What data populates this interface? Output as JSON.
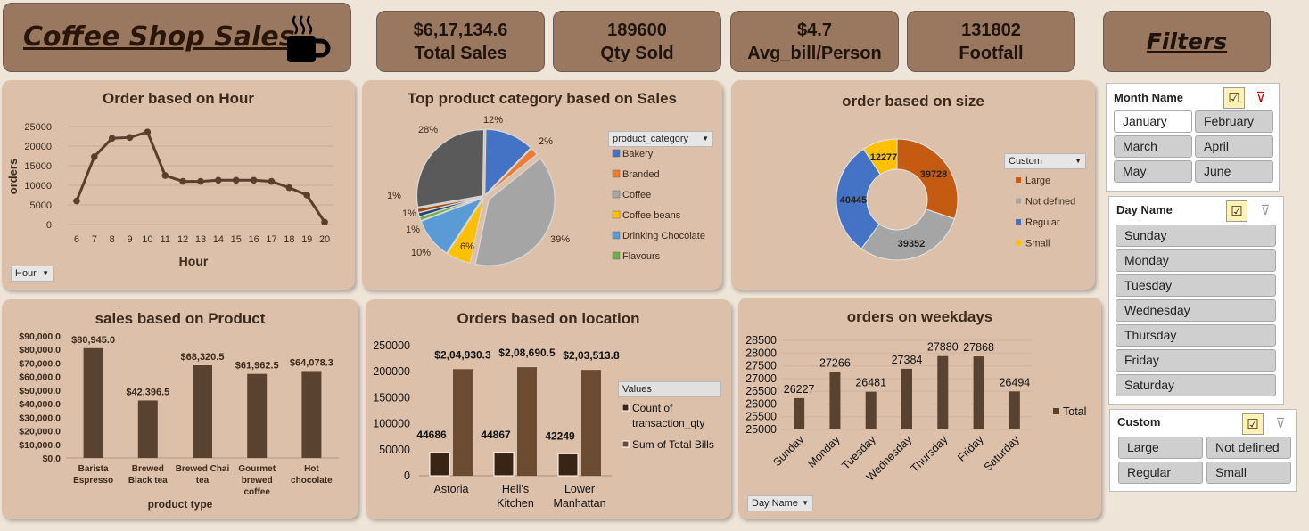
{
  "title": {
    "text": "Coffee Shop Sales",
    "icon": "coffee-cup-icon"
  },
  "kpis": [
    {
      "value": "$6,17,134.6",
      "label": "Total Sales"
    },
    {
      "value": "189600",
      "label": "Qty Sold"
    },
    {
      "value": "$4.7",
      "label": "Avg_bill/Person"
    },
    {
      "value": "131802",
      "label": "Footfall"
    }
  ],
  "filters_label": "Filters",
  "colors": {
    "brown": "#5a4230",
    "panel": "#dcc0aa",
    "header": "#9a7860",
    "blue": "#4472c4",
    "orange": "#ed7d31",
    "grey": "#a5a5a5",
    "gold": "#ffc000",
    "lightblue": "#5b9bd5",
    "green": "#70ad47",
    "darkgrey": "#5a5a5a",
    "rust": "#c55a11"
  },
  "panels": {
    "hour": {
      "title": "Order based on Hour",
      "field_button": "Hour",
      "chart_data": {
        "type": "line",
        "xlabel": "Hour",
        "ylabel": "orders",
        "ylim": [
          0,
          25000
        ],
        "yticks": [
          "25000",
          "20000",
          "15000",
          "10000",
          "5000",
          "0"
        ],
        "x": [
          "6",
          "7",
          "8",
          "9",
          "10",
          "11",
          "12",
          "13",
          "14",
          "15",
          "16",
          "17",
          "18",
          "19",
          "20"
        ],
        "values": [
          6000,
          17300,
          22000,
          22200,
          23600,
          12500,
          11000,
          11000,
          11300,
          11300,
          11300,
          11000,
          9400,
          7500,
          600
        ]
      }
    },
    "category": {
      "title": "Top product category based on Sales",
      "legend_title": "product_category",
      "chart_data": {
        "type": "pie",
        "series": [
          {
            "name": "Bakery",
            "value": 12,
            "label": "12%",
            "color": "#4472c4"
          },
          {
            "name": "Branded",
            "value": 2,
            "label": "2%",
            "color": "#ed7d31"
          },
          {
            "name": "Coffee",
            "value": 39,
            "label": "39%",
            "color": "#a5a5a5"
          },
          {
            "name": "Coffee beans",
            "value": 6,
            "label": "6%",
            "color": "#ffc000"
          },
          {
            "name": "Drinking Chocolate",
            "value": 10,
            "label": "10%",
            "color": "#5b9bd5"
          },
          {
            "name": "Flavours",
            "value": 1,
            "label": "1%",
            "color": "#70ad47"
          },
          {
            "name": "",
            "value": 1,
            "label": "1%",
            "color": "#264478"
          },
          {
            "name": "",
            "value": 1,
            "label": "1%",
            "color": "#9e480e"
          },
          {
            "name": "",
            "value": 28,
            "label": "28%",
            "color": "#5a5a5a"
          }
        ]
      }
    },
    "size": {
      "title": "order based on size",
      "legend_title": "Custom",
      "chart_data": {
        "type": "pie",
        "donut": true,
        "series": [
          {
            "name": "Large",
            "value": 39728,
            "label": "39728",
            "color": "#c55a11"
          },
          {
            "name": "Not defined",
            "value": 39352,
            "label": "39352",
            "color": "#a5a5a5"
          },
          {
            "name": "Regular",
            "value": 40445,
            "label": "40445",
            "color": "#4472c4"
          },
          {
            "name": "Small",
            "value": 12277,
            "label": "12277",
            "color": "#ffc000"
          }
        ]
      }
    },
    "product": {
      "title": "sales based on Product",
      "chart_data": {
        "type": "bar",
        "xlabel": "product type",
        "ylim": [
          0,
          90000
        ],
        "yticks": [
          "$90,000.0",
          "$80,000.0",
          "$70,000.0",
          "$60,000.0",
          "$50,000.0",
          "$40,000.0",
          "$30,000.0",
          "$20,000.0",
          "$10,000.0",
          "$0.0"
        ],
        "categories": [
          "Barista Espresso",
          "Brewed Black tea",
          "Brewed Chai tea",
          "Gourmet brewed coffee",
          "Hot chocolate"
        ],
        "category_lines": [
          [
            "Barista",
            "Espresso"
          ],
          [
            "Brewed",
            "Black tea"
          ],
          [
            "Brewed Chai",
            "tea"
          ],
          [
            "Gourmet",
            "brewed",
            "coffee"
          ],
          [
            "Hot",
            "chocolate"
          ]
        ],
        "values": [
          80945.0,
          42396.5,
          68320.5,
          61962.5,
          64078.3
        ],
        "labels": [
          "$80,945.0",
          "$42,396.5",
          "$68,320.5",
          "$61,962.5",
          "$64,078.3"
        ]
      }
    },
    "location": {
      "title": "Orders based on location",
      "legend_title": "Values",
      "chart_data": {
        "type": "bar",
        "ylim": [
          0,
          250000
        ],
        "yticks": [
          "250000",
          "200000",
          "150000",
          "100000",
          "50000",
          "0"
        ],
        "categories": [
          "Astoria",
          "Hell's Kitchen",
          "Lower Manhattan"
        ],
        "category_lines": [
          [
            "Astoria"
          ],
          [
            "Hell's",
            "Kitchen"
          ],
          [
            "Lower",
            "Manhattan"
          ]
        ],
        "series": [
          {
            "name": "Count of transaction_qty",
            "name_lines": [
              "Count of",
              "transaction_qty"
            ],
            "values": [
              44686,
              44867,
              42249
            ],
            "labels": [
              "44686",
              "44867",
              "42249"
            ],
            "color": "#3a2414"
          },
          {
            "name": "Sum of Total Bills",
            "name_lines": [
              "Sum of Total Bills"
            ],
            "values": [
              204930.3,
              208690.5,
              203513.8
            ],
            "labels": [
              "$2,04,930.3",
              "$2,08,690.5",
              "$2,03,513.8"
            ],
            "color": "#6b4c33"
          }
        ]
      }
    },
    "weekdays": {
      "title": "orders on weekdays",
      "field_button": "Day Name",
      "legend": "Total",
      "chart_data": {
        "type": "bar",
        "ylim": [
          25000,
          28500
        ],
        "yticks": [
          "28500",
          "28000",
          "27500",
          "27000",
          "26500",
          "26000",
          "25500",
          "25000"
        ],
        "categories": [
          "Sunday",
          "Monday",
          "Tuesday",
          "Wednesday",
          "Thursday",
          "Friday",
          "Saturday"
        ],
        "values": [
          26227,
          27266,
          26481,
          27384,
          27880,
          27868,
          26494
        ],
        "labels": [
          "26227",
          "27266",
          "26481",
          "27384",
          "27880",
          "27868",
          "26494"
        ]
      }
    }
  },
  "slicers": {
    "month": {
      "title": "Month Name",
      "items": [
        "January",
        "February",
        "March",
        "April",
        "May",
        "June"
      ],
      "selected": "January"
    },
    "day": {
      "title": "Day Name",
      "items": [
        "Sunday",
        "Monday",
        "Tuesday",
        "Wednesday",
        "Thursday",
        "Friday",
        "Saturday"
      ]
    },
    "custom": {
      "title": "Custom",
      "items": [
        "Large",
        "Not defined",
        "Regular",
        "Small"
      ]
    }
  }
}
